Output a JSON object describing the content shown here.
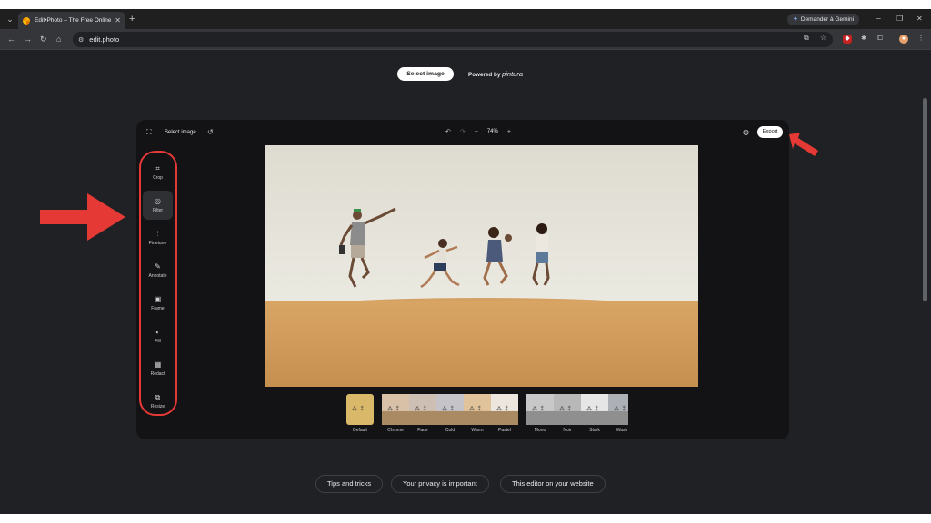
{
  "browser": {
    "tab_title": "Edit•Photo – The Free Online P",
    "tab_close": "✕",
    "new_tab": "+",
    "gemini_button": "Demander à Gemini",
    "url": "edit.photo"
  },
  "page": {
    "select_image_button": "Select image",
    "powered_by": "Powered by",
    "brand": "pintura"
  },
  "editor": {
    "select_image": "Select image",
    "zoom": "74%",
    "zoom_minus": "−",
    "zoom_plus": "+",
    "export": "Export",
    "tools": [
      {
        "label": "Crop",
        "icon": "crop-icon",
        "glyph": "⌗",
        "active": false
      },
      {
        "label": "Filter",
        "icon": "filter-icon",
        "glyph": "◎",
        "active": true
      },
      {
        "label": "Finetune",
        "icon": "finetune-icon",
        "glyph": "⫶",
        "active": false
      },
      {
        "label": "Annotate",
        "icon": "pencil-icon",
        "glyph": "✎",
        "active": false
      },
      {
        "label": "Frame",
        "icon": "frame-icon",
        "glyph": "▣",
        "active": false
      },
      {
        "label": "Fill",
        "icon": "fill-icon",
        "glyph": "◐",
        "active": false
      },
      {
        "label": "Redact",
        "icon": "redact-icon",
        "glyph": "▦",
        "active": false
      },
      {
        "label": "Resize",
        "icon": "resize-icon",
        "glyph": "⧉",
        "active": false
      }
    ],
    "filters": [
      {
        "name": "Default",
        "color": "#d9b86a"
      },
      {
        "name": "Chrome",
        "color": "#d9c1a8"
      },
      {
        "name": "Fade",
        "color": "#cdbfb3"
      },
      {
        "name": "Cold",
        "color": "#c5c3c8"
      },
      {
        "name": "Warm",
        "color": "#e0c39a"
      },
      {
        "name": "Pastel",
        "color": "#ece6df"
      },
      {
        "name": "Mono",
        "color": "#c8c8c8"
      },
      {
        "name": "Noir",
        "color": "#b8b8b8"
      },
      {
        "name": "Stark",
        "color": "#e6e6e6"
      },
      {
        "name": "Wash",
        "color": "#aeb0b8"
      }
    ]
  },
  "footer": {
    "links": [
      "Tips and tricks",
      "Your privacy is important",
      "This editor on your website"
    ]
  },
  "colors": {
    "annotation_red": "#e53935",
    "page_bg": "#202124",
    "editor_bg": "#131316"
  }
}
